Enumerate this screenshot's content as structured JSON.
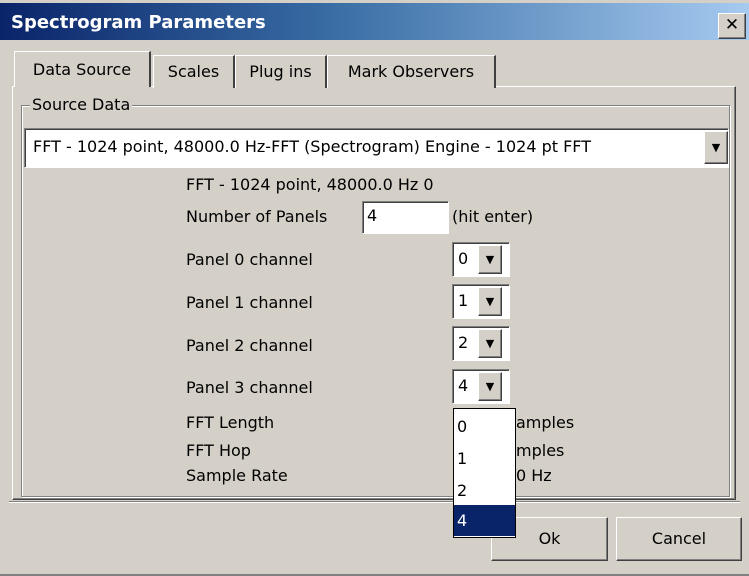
{
  "window": {
    "title": "Spectrogram Parameters",
    "close_glyph": "✕"
  },
  "tabs": [
    {
      "label": "Data Source",
      "active": true
    },
    {
      "label": "Scales",
      "active": false
    },
    {
      "label": "Plug ins",
      "active": false
    },
    {
      "label": "Mark Observers",
      "active": false
    }
  ],
  "source": {
    "group_label": "Source Data",
    "selected": "FFT - 1024 point, 48000.0 Hz-FFT (Spectrogram) Engine - 1024 pt FFT",
    "info_line": "FFT - 1024 point, 48000.0 Hz 0",
    "num_panels_label": "Number of Panels",
    "num_panels_value": "4",
    "num_panels_hint": "(hit enter)",
    "panels": [
      {
        "label": "Panel 0 channel",
        "value": "0"
      },
      {
        "label": "Panel 1 channel",
        "value": "1"
      },
      {
        "label": "Panel 2 channel",
        "value": "2"
      },
      {
        "label": "Panel 3 channel",
        "value": "4"
      }
    ],
    "fft_length_label": "FFT Length",
    "fft_length_value": "amples",
    "fft_hop_label": "FFT Hop",
    "fft_hop_value": "mples",
    "sample_rate_label": "Sample Rate",
    "sample_rate_value": "0 Hz"
  },
  "dropdown": {
    "options": [
      "0",
      "1",
      "2",
      "4"
    ],
    "selected_index": 3
  },
  "buttons": {
    "ok": "Ok",
    "cancel": "Cancel"
  },
  "icons": {
    "combo_arrow": "▼"
  },
  "colors": {
    "title_start": "#0a246a",
    "title_end": "#a6caf0",
    "face": "#d4d0c8",
    "selection": "#0a246a"
  }
}
